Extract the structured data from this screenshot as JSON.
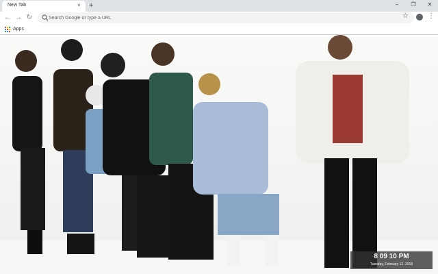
{
  "tab": {
    "title": "New Tab",
    "close": "×"
  },
  "new_tab": "+",
  "window_controls": {
    "minimize": "–",
    "maximize": "❐",
    "close": "✕"
  },
  "nav": {
    "back": "←",
    "forward": "→",
    "reload": "↻"
  },
  "omnibox": {
    "placeholder": "Search Google or type a URL",
    "value": ""
  },
  "toolbar_icons": {
    "star": "☆",
    "menu": "⋮"
  },
  "bookmarks": {
    "apps_label": "Apps"
  },
  "clock": {
    "time": "8 09 10 PM",
    "date": "Tuesday, February 12, 2019"
  },
  "colors": {
    "tabstrip": "#dee1e6",
    "apps_dots": [
      "#ea4335",
      "#fbbc05",
      "#34a853",
      "#4285f4",
      "#ea4335",
      "#fbbc05",
      "#34a853",
      "#4285f4",
      "#ea4335"
    ]
  },
  "icons": [
    "search-icon",
    "star-icon",
    "profile-icon",
    "menu-icon",
    "apps-icon",
    "back-icon",
    "forward-icon",
    "reload-icon"
  ]
}
